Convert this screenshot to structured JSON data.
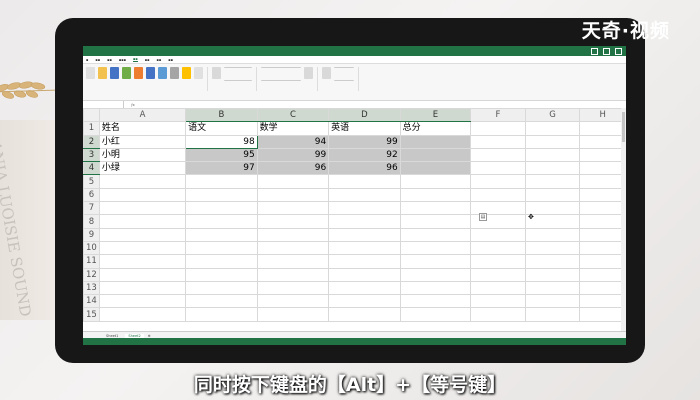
{
  "watermark": "天奇·视频",
  "caption": "同时按下键盘的【Alt】+【等号键】",
  "background_text": "LANIA LUOISIE SOUND",
  "excel": {
    "columns": [
      "A",
      "B",
      "C",
      "D",
      "E",
      "F",
      "G",
      "H"
    ],
    "rows": [
      "1",
      "2",
      "3",
      "4",
      "5",
      "6",
      "7",
      "8",
      "9",
      "10",
      "11",
      "12",
      "13",
      "14",
      "15"
    ],
    "header": {
      "name": "姓名",
      "chinese": "语文",
      "math": "数学",
      "english": "英语",
      "total": "总分"
    },
    "students": [
      {
        "name": "小红",
        "chinese": "98",
        "math": "94",
        "english": "99"
      },
      {
        "name": "小明",
        "chinese": "95",
        "math": "99",
        "english": "92"
      },
      {
        "name": "小绿",
        "chinese": "97",
        "math": "96",
        "english": "96"
      }
    ],
    "selected_range": "B2:E4",
    "sheet_tabs": [
      "Sheet1",
      "Sheet2"
    ],
    "active_sheet": "Sheet2"
  },
  "colors": {
    "excel_green": "#217346",
    "selection_gray": "#c8c8c8",
    "monitor": "#171717"
  }
}
